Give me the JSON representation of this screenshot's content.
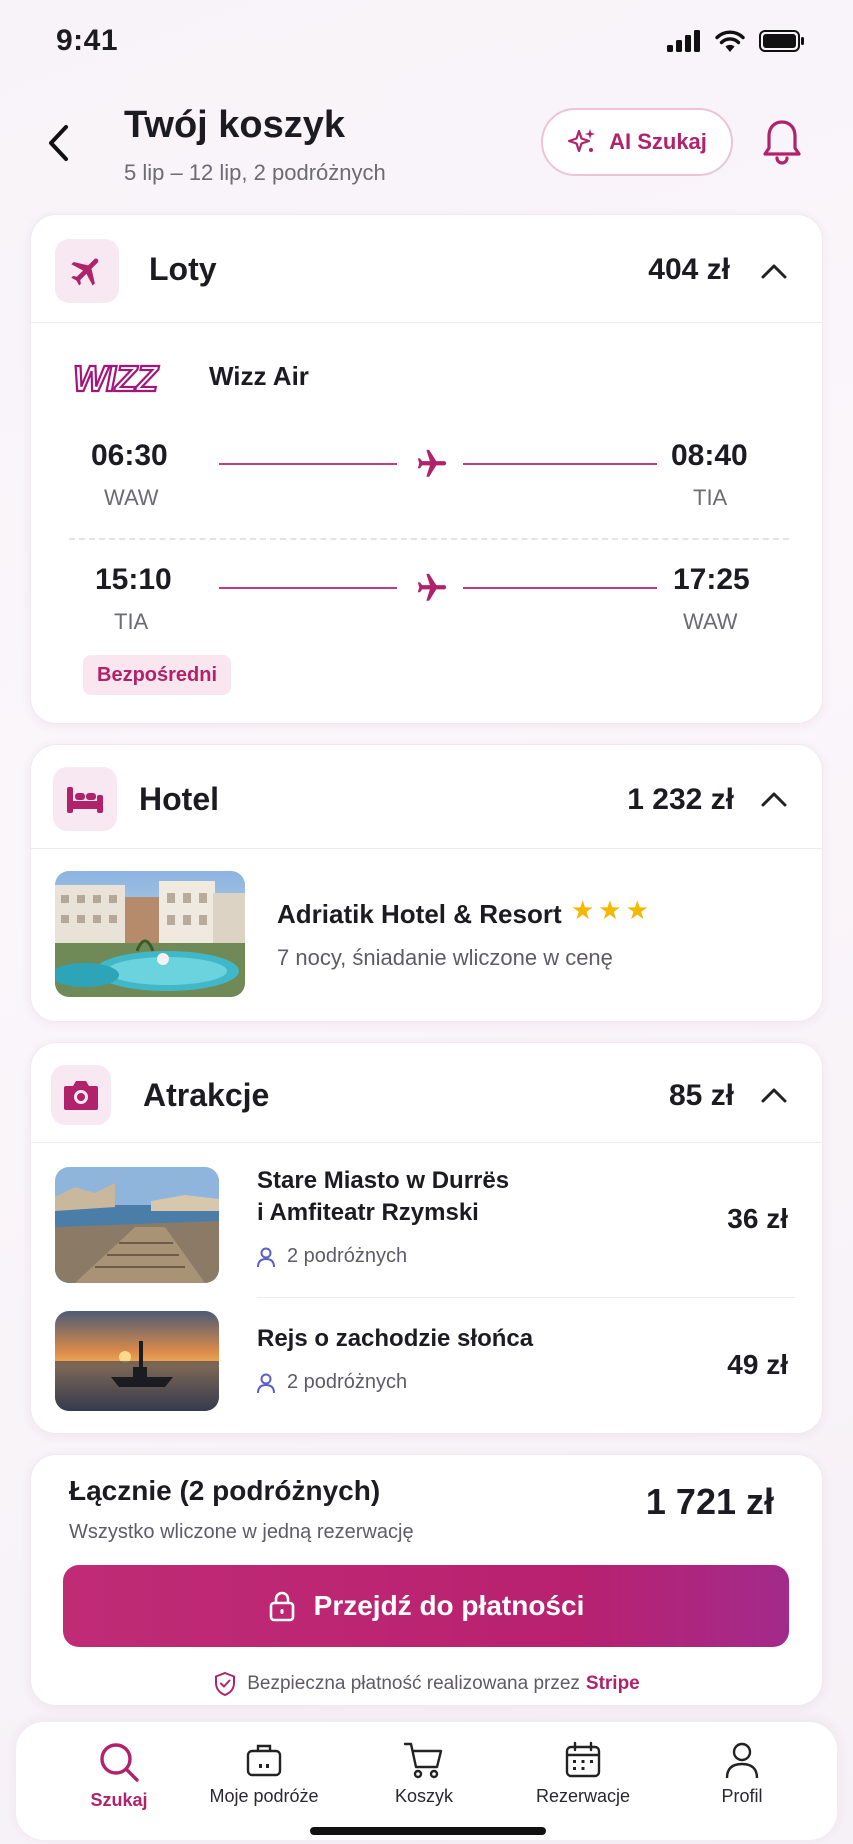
{
  "status": {
    "time": "9:41"
  },
  "header": {
    "title": "Twój koszyk",
    "subtitle": "5 lip – 12 lip, 2 podróżnych",
    "ai_button": "AI Szukaj"
  },
  "flights": {
    "title": "Loty",
    "price": "404 zł",
    "airline_logo": "WIZZ",
    "airline": "Wizz Air",
    "outbound": {
      "dep_time": "06:30",
      "dep_code": "WAW",
      "arr_time": "08:40",
      "arr_code": "TIA"
    },
    "return": {
      "dep_time": "15:10",
      "dep_code": "TIA",
      "arr_time": "17:25",
      "arr_code": "WAW"
    },
    "badge": "Bezpośredni"
  },
  "hotel": {
    "title": "Hotel",
    "price": "1 232 zł",
    "name": "Adriatik Hotel & Resort",
    "stars": "★★★",
    "description": "7 nocy, śniadanie wliczone w cenę"
  },
  "attractions": {
    "title": "Atrakcje",
    "price": "85 zł",
    "items": [
      {
        "title_line1": "Stare Miasto w Durrës",
        "title_line2": "i Amfiteatr Rzymski",
        "travelers": "2 podróżnych",
        "price": "36 zł"
      },
      {
        "title_line1": "Rejs o zachodzie słońca",
        "travelers": "2 podróżnych",
        "price": "49 zł"
      }
    ]
  },
  "total": {
    "label": "Łącznie (2 podróżnych)",
    "sublabel": "Wszystko wliczone w jedną rezerwację",
    "value": "1 721 zł",
    "pay_button": "Przejdź do płatności",
    "secure_text": "Bezpieczna płatność realizowana przez",
    "secure_brand": "Stripe"
  },
  "tabs": [
    {
      "label": "Szukaj",
      "icon": "search-icon",
      "active": true
    },
    {
      "label": "Moje podróże",
      "icon": "suitcase-icon"
    },
    {
      "label": "Koszyk",
      "icon": "cart-icon"
    },
    {
      "label": "Rezerwacje",
      "icon": "calendar-icon"
    },
    {
      "label": "Profil",
      "icon": "person-icon"
    }
  ],
  "colors": {
    "accent": "#b0236a",
    "star": "#f5b800"
  }
}
